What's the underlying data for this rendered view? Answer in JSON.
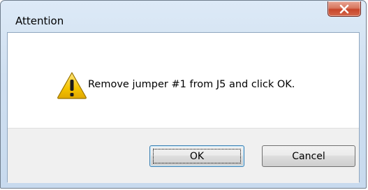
{
  "dialog": {
    "title": "Attention",
    "message": "Remove jumper #1 from J5 and click OK.",
    "close_glyph": "X"
  },
  "buttons": {
    "ok_label": "OK",
    "cancel_label": "Cancel"
  },
  "icons": {
    "warning": "warning-icon",
    "close": "close-icon"
  },
  "colors": {
    "warning_fill": "#f5c400",
    "close_button": "#c8452a",
    "window_frame": "#cfdff0"
  }
}
